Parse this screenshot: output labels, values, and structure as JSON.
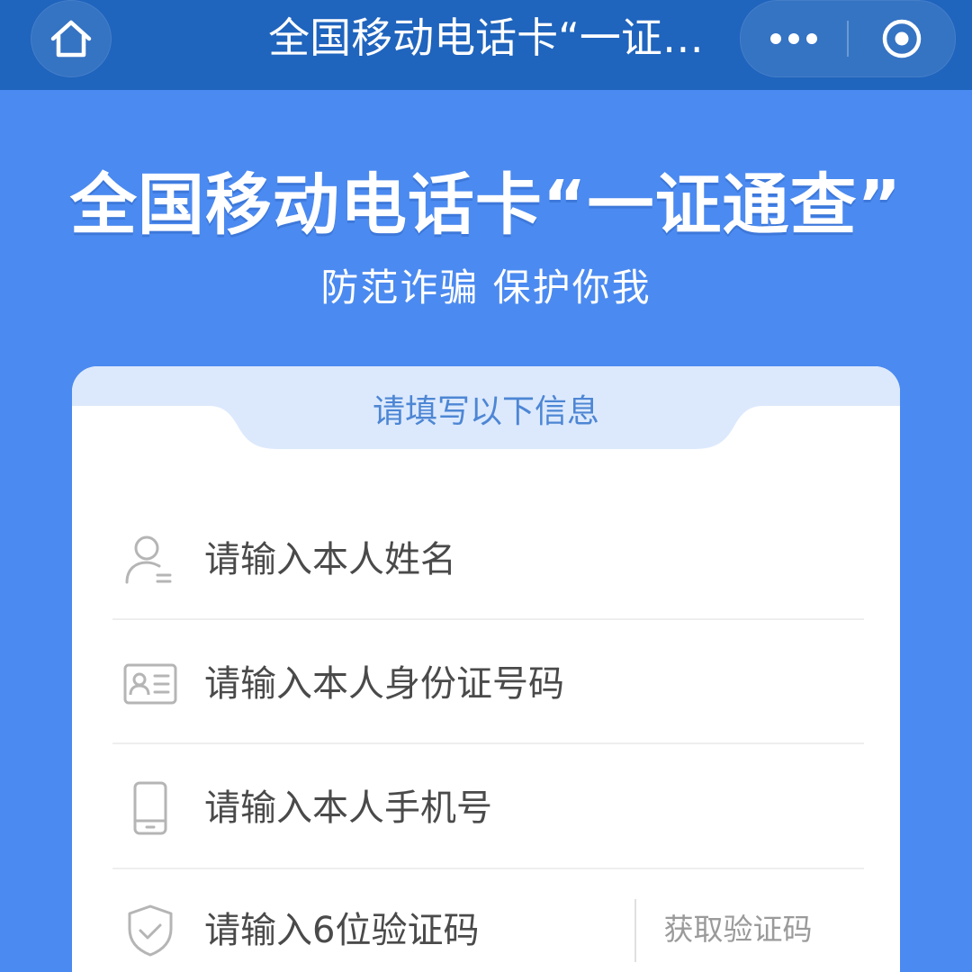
{
  "nav": {
    "title": "全国移动电话卡“一证…",
    "home_icon": "home-icon",
    "more_icon": "more-dots-icon",
    "close_icon": "target-close-icon"
  },
  "hero": {
    "title": "全国移动电话卡“一证通查”",
    "subtitle": "防范诈骗 保护你我"
  },
  "form": {
    "header": "请填写以下信息",
    "name": {
      "placeholder": "请输入本人姓名",
      "icon": "user-icon"
    },
    "id_number": {
      "placeholder": "请输入本人身份证号码",
      "icon": "id-card-icon"
    },
    "phone": {
      "placeholder": "请输入本人手机号",
      "icon": "phone-icon"
    },
    "code": {
      "placeholder": "请输入6位验证码",
      "icon": "shield-check-icon",
      "button": "获取验证码"
    }
  },
  "colors": {
    "background": "#4b8af0",
    "nav_bar": "#1f64bd",
    "card_header": "#dce9fd",
    "header_text": "#4d86d4"
  }
}
